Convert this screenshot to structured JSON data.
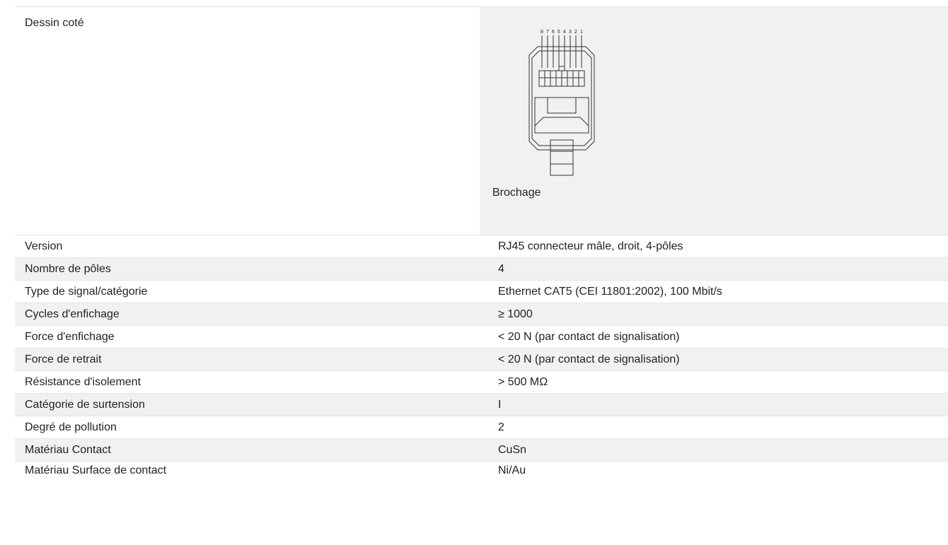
{
  "table": {
    "drawing_row": {
      "label": "Dessin coté",
      "caption": "Brochage",
      "pin_numbers": [
        "8",
        "7",
        "6",
        "5",
        "4",
        "3",
        "2",
        "1"
      ]
    },
    "rows": [
      {
        "label": "Version",
        "value": "RJ45 connecteur mâle, droit, 4-pôles"
      },
      {
        "label": "Nombre de pôles",
        "value": "4"
      },
      {
        "label": "Type de signal/catégorie",
        "value": "Ethernet CAT5 (CEI 11801:2002), 100 Mbit/s"
      },
      {
        "label": "Cycles d'enfichage",
        "value": "≥ 1000"
      },
      {
        "label": "Force d'enfichage",
        "value": "< 20 N (par contact de signalisation)"
      },
      {
        "label": "Force de retrait",
        "value": "< 20 N (par contact de signalisation)"
      },
      {
        "label": "Résistance d'isolement",
        "value": "> 500 MΩ"
      },
      {
        "label": "Catégorie de surtension",
        "value": "I"
      },
      {
        "label": "Degré de pollution",
        "value": "2"
      },
      {
        "label": "Matériau Contact",
        "value": "CuSn"
      },
      {
        "label": "Matériau Surface de contact",
        "value": "Ni/Au"
      }
    ]
  }
}
